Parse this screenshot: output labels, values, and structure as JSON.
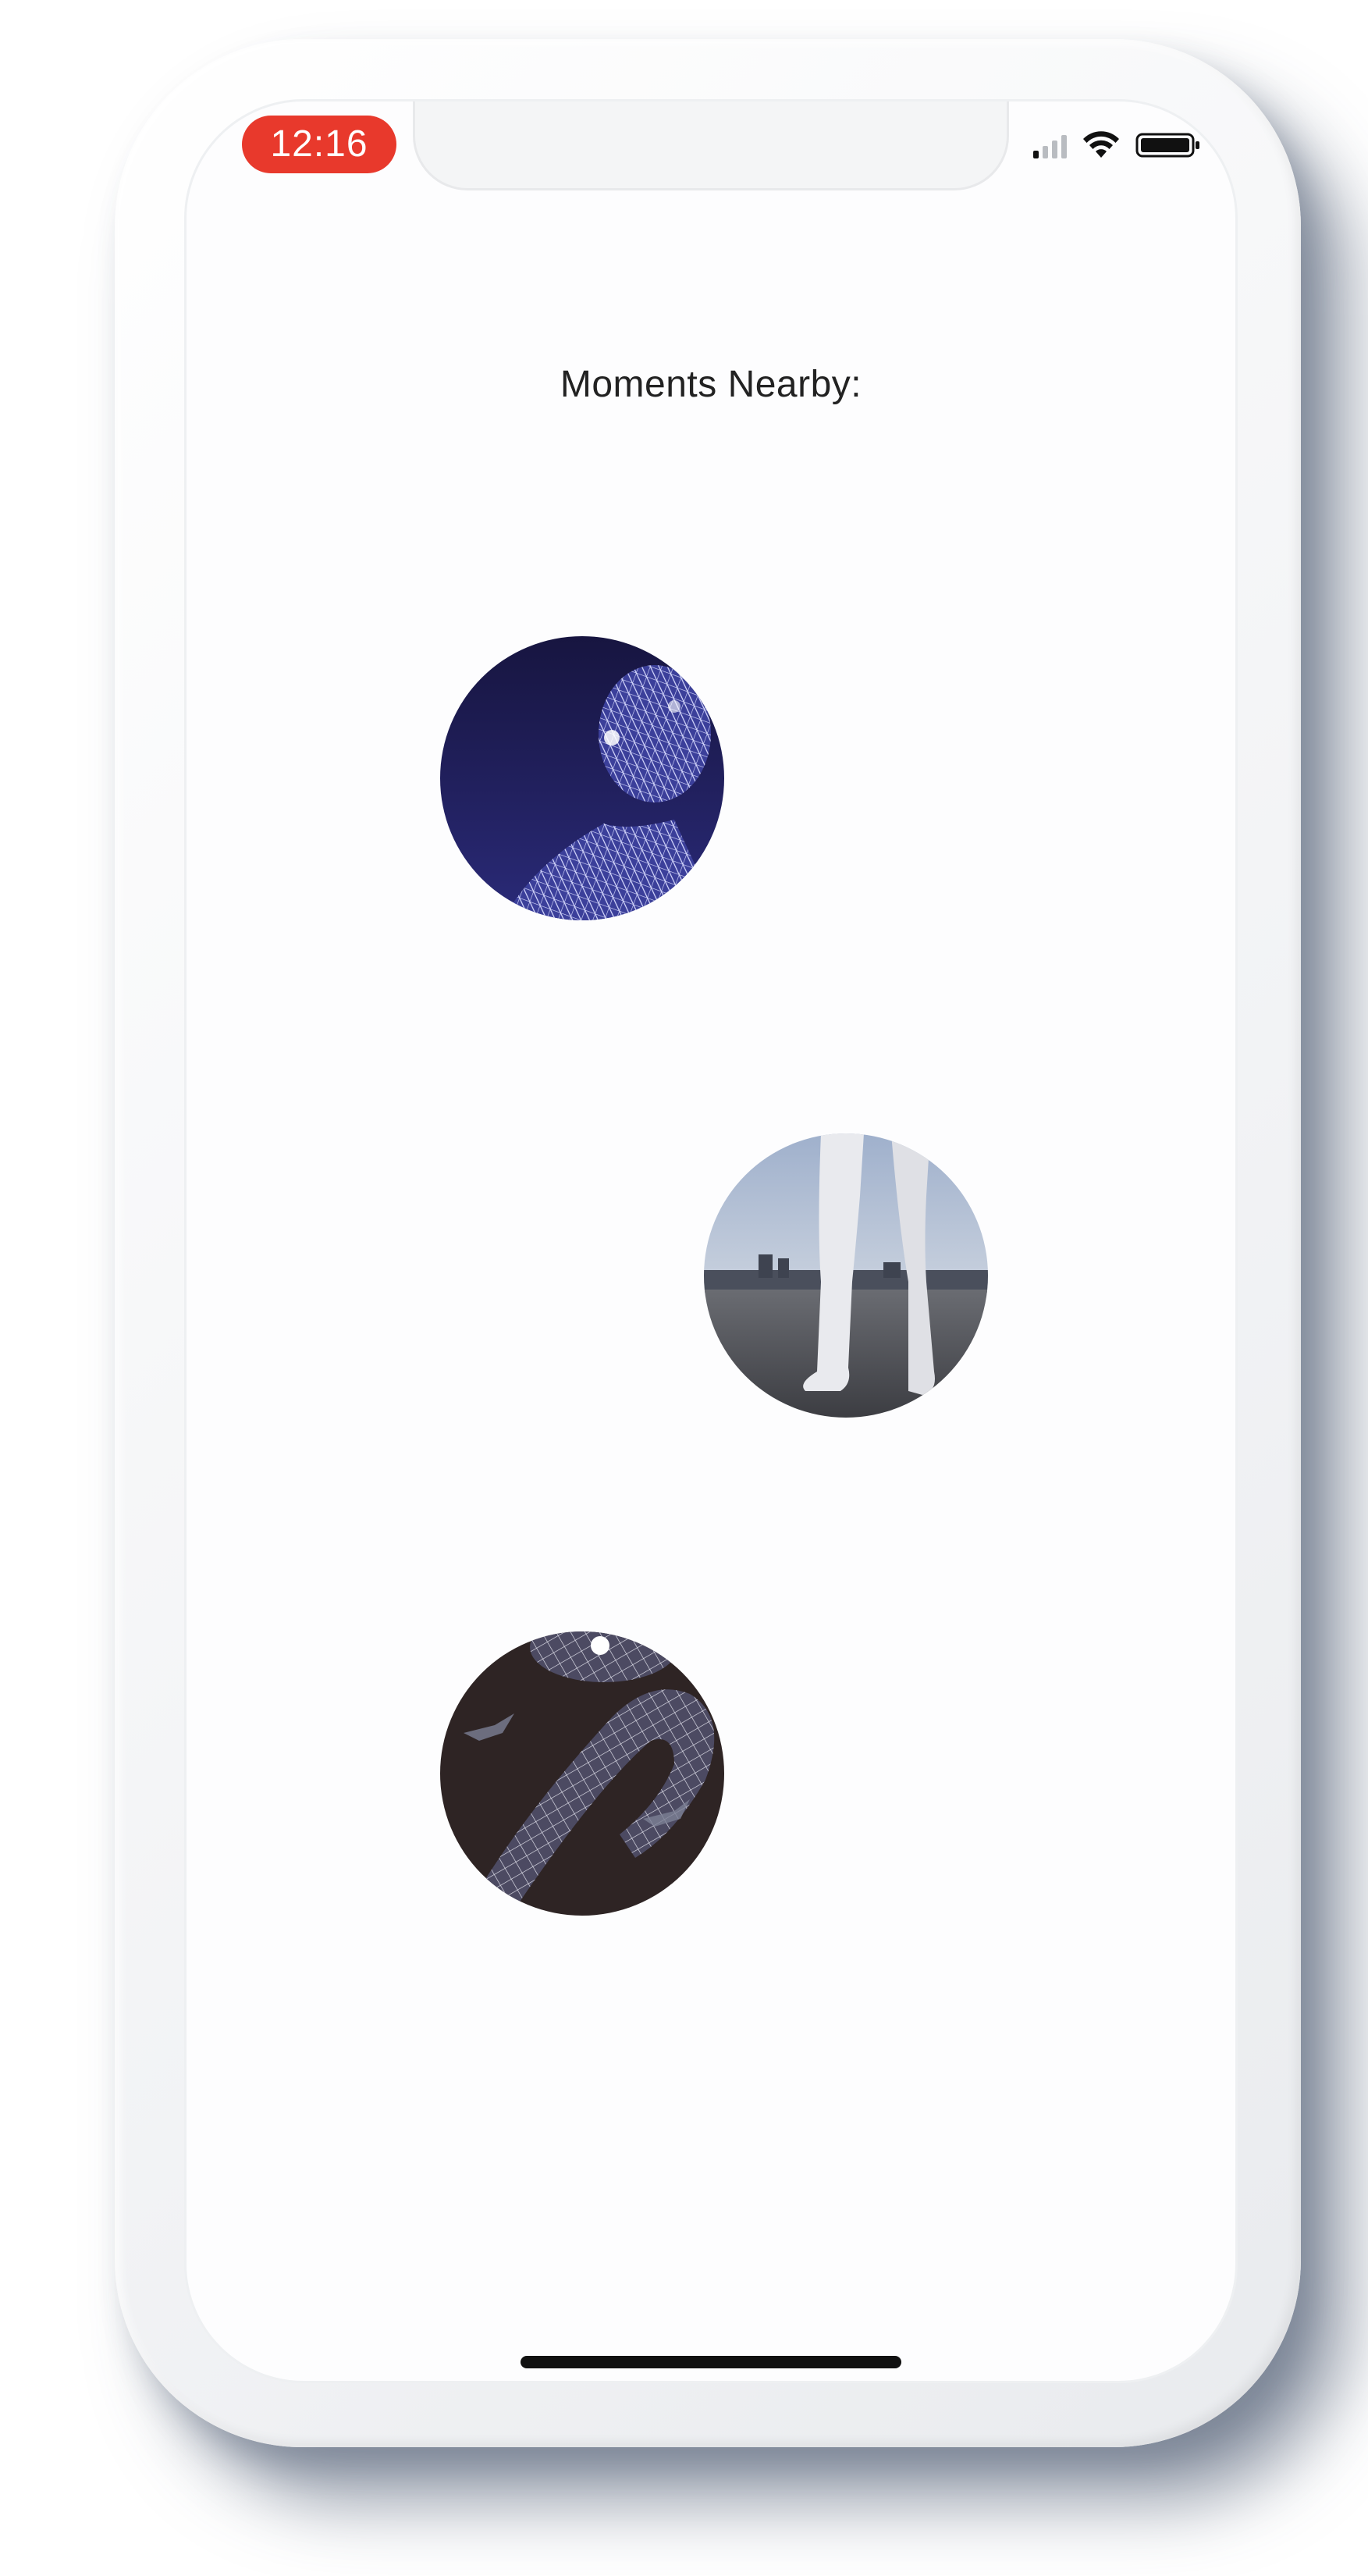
{
  "status_bar": {
    "time": "12:16",
    "signal_icon": "cellular-signal-icon",
    "wifi_icon": "wifi-icon",
    "battery_icon": "battery-icon"
  },
  "main": {
    "title": "Moments Nearby:",
    "moments": [
      {
        "icon": "wireframe-head-thumbnail"
      },
      {
        "icon": "legs-on-shore-thumbnail"
      },
      {
        "icon": "wireframe-limb-thumbnail"
      }
    ]
  },
  "colors": {
    "time_pill": "#e8392c",
    "screen_bg": "#fdfdfe",
    "text": "#222222",
    "home_indicator": "#111111"
  }
}
